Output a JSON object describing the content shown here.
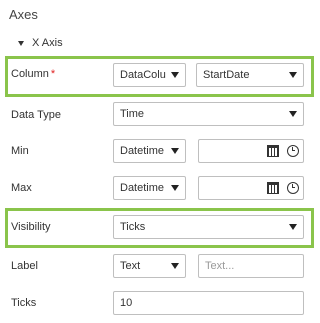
{
  "panel": {
    "title": "Axes",
    "subsection": "X Axis"
  },
  "rows": {
    "column": {
      "label": "Column",
      "required_mark": "*",
      "select1": "DataColu",
      "select2": "StartDate"
    },
    "data_type": {
      "label": "Data Type",
      "select": "Time"
    },
    "min": {
      "label": "Min",
      "select": "Datetime",
      "value": ""
    },
    "max": {
      "label": "Max",
      "select": "Datetime",
      "value": ""
    },
    "visibility": {
      "label": "Visibility",
      "select": "Ticks"
    },
    "label": {
      "label": "Label",
      "select": "Text",
      "placeholder": "Text..."
    },
    "ticks": {
      "label": "Ticks",
      "value": "10"
    }
  },
  "colors": {
    "highlight": "#8ac44b",
    "required": "#e02020"
  },
  "icons": [
    "chevron-down-icon",
    "calendar-icon",
    "clock-icon",
    "triangle-down-icon"
  ]
}
